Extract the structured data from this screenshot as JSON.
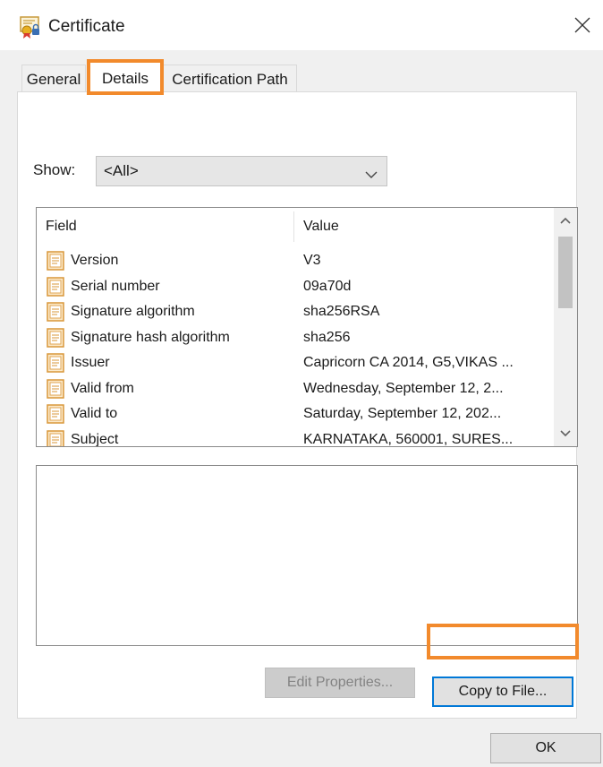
{
  "window": {
    "title": "Certificate",
    "title_icon": "certificate-icon",
    "close_glyph": "✕"
  },
  "tabs": [
    {
      "label": "General",
      "selected": false
    },
    {
      "label": "Details",
      "selected": true
    },
    {
      "label": "Certification Path",
      "selected": false
    }
  ],
  "show": {
    "label": "Show:",
    "selected": "<All>"
  },
  "fields_table": {
    "columns": [
      "Field",
      "Value"
    ],
    "rows": [
      {
        "field": "Version",
        "value": "V3"
      },
      {
        "field": "Serial number",
        "value": "09a70d"
      },
      {
        "field": "Signature algorithm",
        "value": "sha256RSA"
      },
      {
        "field": "Signature hash algorithm",
        "value": "sha256"
      },
      {
        "field": "Issuer",
        "value": "Capricorn CA 2014, G5,VIKAS ..."
      },
      {
        "field": "Valid from",
        "value": "Wednesday, September 12, 2..."
      },
      {
        "field": "Valid to",
        "value": "Saturday, September 12, 202..."
      },
      {
        "field": "Subject",
        "value": "KARNATAKA, 560001, SURES..."
      }
    ]
  },
  "buttons": {
    "edit_properties": "Edit Properties...",
    "copy_to_file": "Copy to File...",
    "ok": "OK"
  },
  "colors": {
    "highlight": "#f28a2c",
    "focus_border": "#0078d7",
    "dialog_bg": "#f0f0f0"
  }
}
